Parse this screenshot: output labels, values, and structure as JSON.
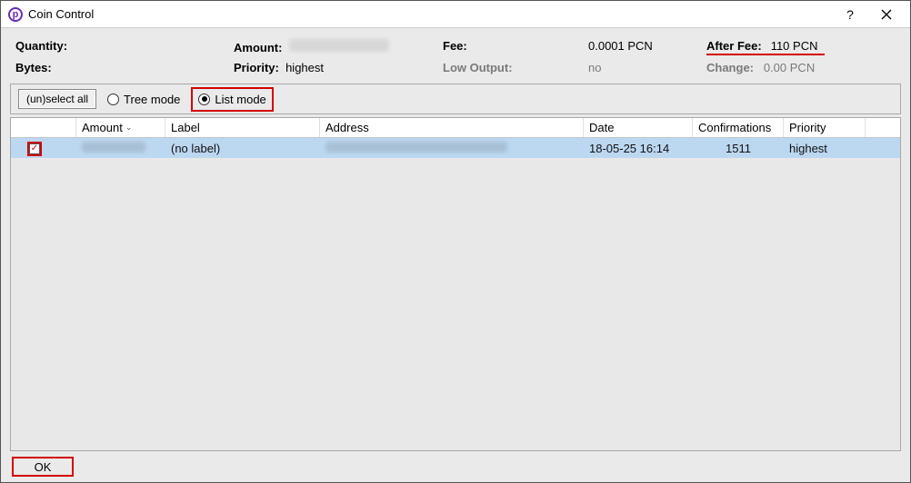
{
  "title": "Coin Control",
  "icon_letter": "p",
  "stats": {
    "quantity_label": "Quantity:",
    "amount_label": "Amount:",
    "fee_label": "Fee:",
    "fee_value": "0.0001 PCN",
    "after_fee_label": "After Fee:",
    "after_fee_value": "110 PCN",
    "bytes_label": "Bytes:",
    "priority_label": "Priority:",
    "priority_value": "highest",
    "low_output_label": "Low Output:",
    "low_output_value": "no",
    "change_label": "Change:",
    "change_value": "0.00 PCN"
  },
  "toolbar": {
    "unselect_label": "(un)select all",
    "tree_label": "Tree mode",
    "list_label": "List mode"
  },
  "columns": {
    "amount": "Amount",
    "label": "Label",
    "address": "Address",
    "date": "Date",
    "confirmations": "Confirmations",
    "priority": "Priority"
  },
  "rows": [
    {
      "label": "(no label)",
      "date": "18-05-25 16:14",
      "confirmations": "1511",
      "priority": "highest"
    }
  ],
  "ok_label": "OK"
}
